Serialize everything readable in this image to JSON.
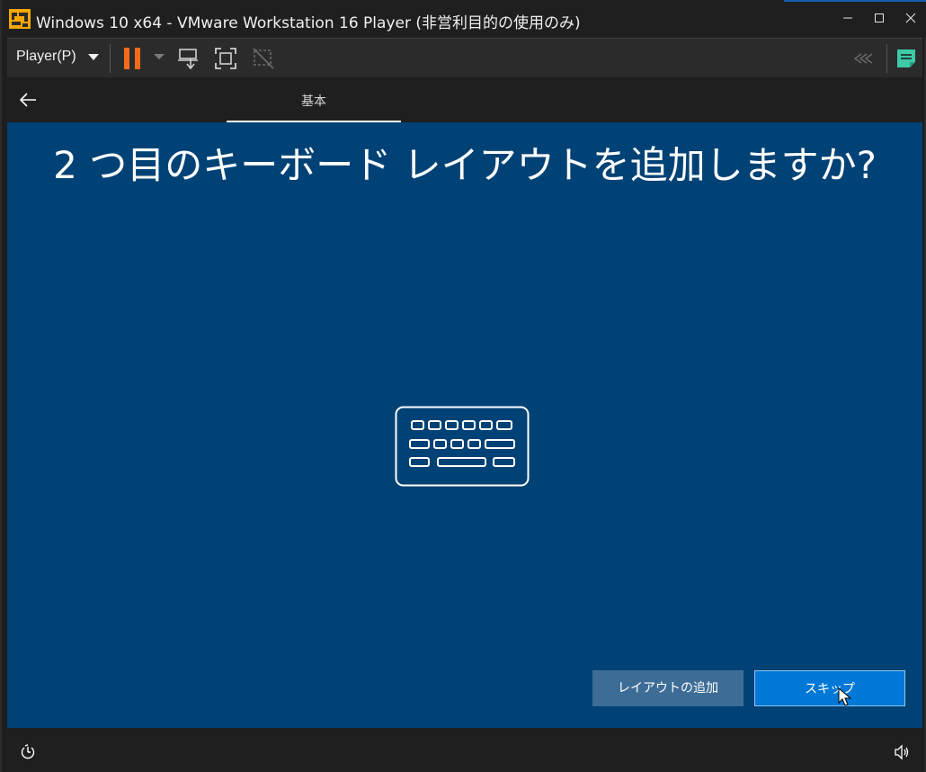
{
  "titlebar": {
    "title": "Windows 10 x64 - VMware Workstation 16 Player (非営利目的の使用のみ)",
    "minimize_icon": "minimize-icon",
    "maximize_icon": "maximize-icon",
    "close_icon": "close-icon",
    "app_icon": "vmware-icon"
  },
  "toolbar": {
    "player_menu": "Player(P)",
    "icons": [
      "pause-icon",
      "send-ctrl-alt-del-icon",
      "fullscreen-icon",
      "unity-icon",
      "collapse-icon",
      "note-icon"
    ],
    "pause_color": "#f06b1c"
  },
  "vm": {
    "tab_label": "基本",
    "heading": "2 つ目のキーボード レイアウトを追加しますか?",
    "add_layout_button": "レイアウトの追加",
    "skip_button": "スキップ",
    "background_color": "#004275",
    "accent_color": "#0078d7"
  }
}
